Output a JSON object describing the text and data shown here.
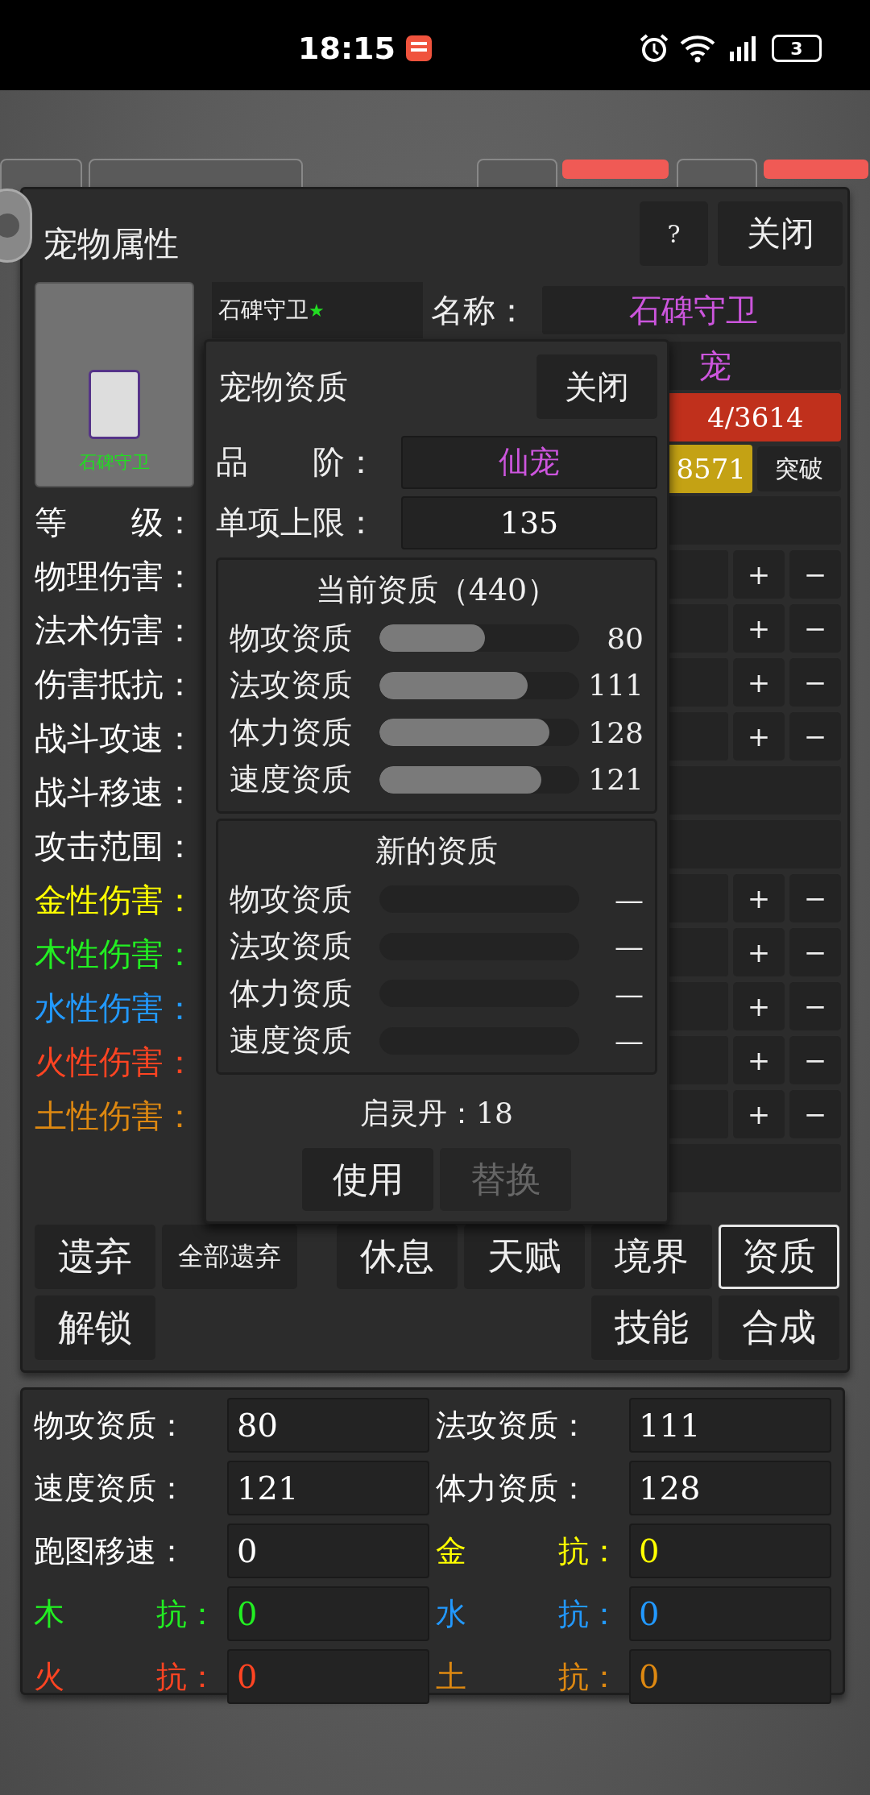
{
  "status_bar": {
    "time": "18:15",
    "battery": "3"
  },
  "pet_panel": {
    "title": "宠物属性",
    "help_button": "?",
    "close_button": "关闭",
    "portrait": {
      "name": "石碑守卫"
    },
    "list_entry": {
      "name": "石碑守卫",
      "star": "★"
    },
    "name_field": {
      "label": "名称：",
      "value": "石碑守卫"
    },
    "grade_value": "宠",
    "hp_reading": "4/3614",
    "exp_reading": "8571",
    "breakthrough_button": "突破",
    "stat_labels": [
      {
        "label": "等　　级：",
        "color": "#ffffff"
      },
      {
        "label": "物理伤害：",
        "color": "#ffffff"
      },
      {
        "label": "法术伤害：",
        "color": "#ffffff"
      },
      {
        "label": "伤害抵抗：",
        "color": "#ffffff"
      },
      {
        "label": "战斗攻速：",
        "color": "#ffffff"
      },
      {
        "label": "战斗移速：",
        "color": "#ffffff"
      },
      {
        "label": "攻击范围：",
        "color": "#ffffff"
      },
      {
        "label": "金性伤害：",
        "color": "#ffff00"
      },
      {
        "label": "木性伤害：",
        "color": "#22ee22"
      },
      {
        "label": "水性伤害：",
        "color": "#2299ff"
      },
      {
        "label": "火性伤害：",
        "color": "#ff4422"
      },
      {
        "label": "土性伤害：",
        "color": "#dd8811"
      }
    ],
    "right_rows": [
      {
        "kind": "box"
      },
      {
        "kind": "adjust",
        "plus": "+",
        "minus": "−"
      },
      {
        "kind": "adjust",
        "plus": "+",
        "minus": "−"
      },
      {
        "kind": "adjust",
        "plus": "+",
        "minus": "−"
      },
      {
        "kind": "adjust",
        "plus": "+",
        "minus": "−"
      },
      {
        "kind": "box"
      },
      {
        "kind": "box"
      },
      {
        "kind": "adjust",
        "plus": "+",
        "minus": "−"
      },
      {
        "kind": "adjust",
        "plus": "+",
        "minus": "−"
      },
      {
        "kind": "adjust",
        "plus": "+",
        "minus": "−"
      },
      {
        "kind": "adjust",
        "plus": "+",
        "minus": "−"
      },
      {
        "kind": "adjust",
        "plus": "+",
        "minus": "−"
      },
      {
        "kind": "box"
      }
    ],
    "action_rows": [
      {
        "left": [
          {
            "label": "遗弃",
            "selected": false
          },
          {
            "label": "全部遗弃",
            "selected": false
          }
        ],
        "right": [
          {
            "label": "休息",
            "selected": false
          },
          {
            "label": "天赋",
            "selected": false
          },
          {
            "label": "境界",
            "selected": false
          },
          {
            "label": "资质",
            "selected": true
          }
        ]
      },
      {
        "left": [
          {
            "label": "解锁",
            "selected": false
          }
        ],
        "right": [
          {
            "label": "技能",
            "selected": false
          },
          {
            "label": "合成",
            "selected": false
          }
        ]
      }
    ]
  },
  "aptitude_popup": {
    "title": "宠物资质",
    "close_button": "关闭",
    "fields": [
      {
        "label": "品　　阶：",
        "value": "仙宠",
        "color": "#cc55dd"
      },
      {
        "label": "单项上限：",
        "value": "135",
        "color": "#ffffff"
      }
    ],
    "sections": [
      {
        "title": "当前资质（440）",
        "rows": [
          {
            "label": "物攻资质",
            "level": 0.53,
            "value": "80"
          },
          {
            "label": "法攻资质",
            "level": 0.74,
            "value": "111"
          },
          {
            "label": "体力资质",
            "level": 0.85,
            "value": "128"
          },
          {
            "label": "速度资质",
            "level": 0.81,
            "value": "121"
          }
        ]
      },
      {
        "title": "新的资质",
        "rows": [
          {
            "label": "物攻资质",
            "level": 0,
            "value": "—"
          },
          {
            "label": "法攻资质",
            "level": 0,
            "value": "—"
          },
          {
            "label": "体力资质",
            "level": 0,
            "value": "—"
          },
          {
            "label": "速度资质",
            "level": 0,
            "value": "—"
          }
        ]
      }
    ],
    "pill_count": "启灵丹：18",
    "buttons": [
      {
        "label": "使用",
        "disabled": false
      },
      {
        "label": "替换",
        "disabled": true
      }
    ]
  },
  "aptitude_summary": [
    {
      "label": "物攻资质：",
      "value": "80",
      "color": "#ffffff"
    },
    {
      "label": "法攻资质：",
      "value": "111",
      "color": "#ffffff"
    },
    {
      "label": "速度资质：",
      "value": "121",
      "color": "#ffffff"
    },
    {
      "label": "体力资质：",
      "value": "128",
      "color": "#ffffff"
    },
    {
      "label": "跑图移速：",
      "value": "0",
      "color": "#ffffff"
    },
    {
      "label": "金　　　抗：",
      "value": "0",
      "color": "#ffff00"
    },
    {
      "label": "木　　　抗：",
      "value": "0",
      "color": "#22ee22"
    },
    {
      "label": "水　　　抗：",
      "value": "0",
      "color": "#2299ff"
    },
    {
      "label": "火　　　抗：",
      "value": "0",
      "color": "#ff4422"
    },
    {
      "label": "土　　　抗：",
      "value": "0",
      "color": "#dd8811"
    }
  ]
}
